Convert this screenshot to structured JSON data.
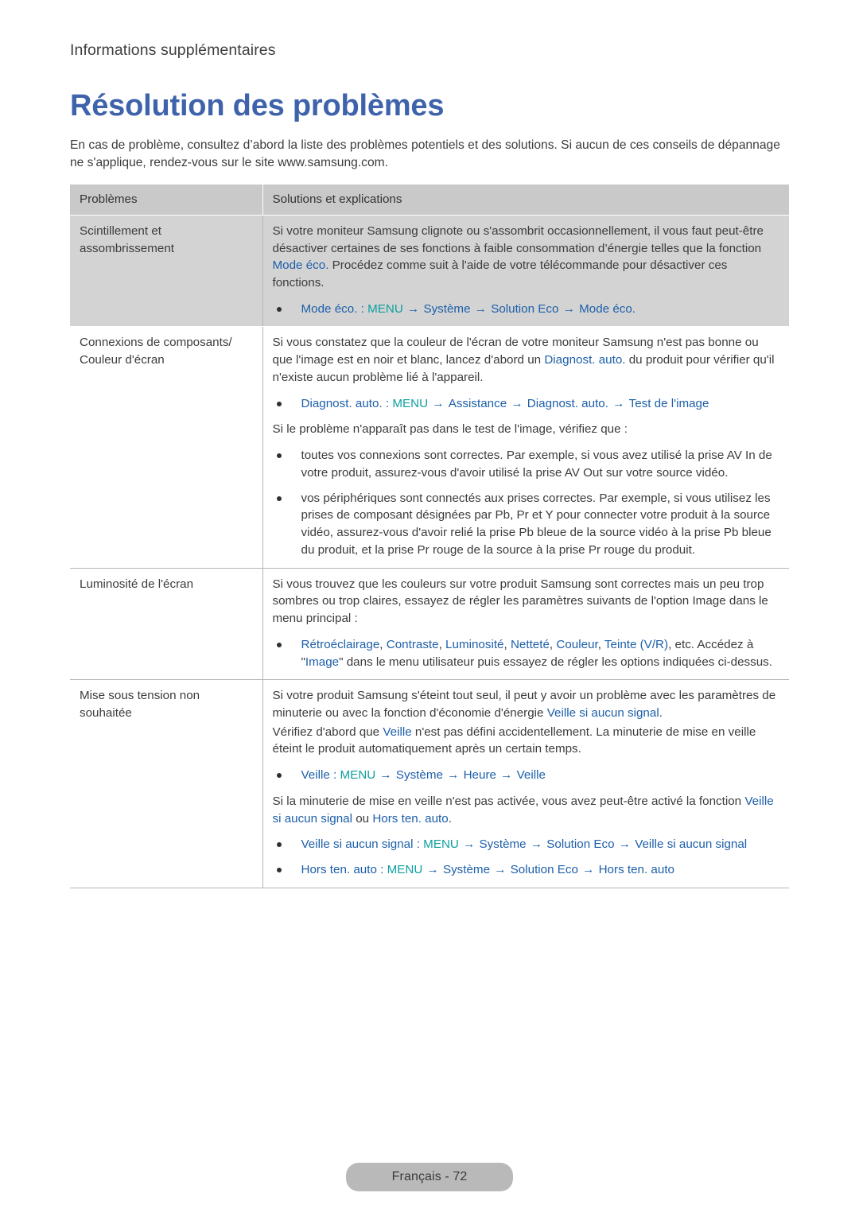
{
  "page": {
    "running_head": "Informations supplémentaires",
    "title": "Résolution des problèmes",
    "intro": "En cas de problème, consultez d’abord la liste des problèmes potentiels et des solutions. Si aucun de ces conseils de dépannage ne s'applique, rendez-vous sur le site www.samsung.com.",
    "footer": "Français - 72"
  },
  "colors": {
    "title_blue": "#3f63ab",
    "link_blue": "#1d5fa9",
    "menu_teal": "#0f9f9f",
    "header_gray": "#c9c9c9",
    "row_gray": "#d3d3d3",
    "rule_gray": "#b5b5b5",
    "footer_pill": "#b9b9b9",
    "body_text": "#3c3c3c"
  },
  "table": {
    "headers": {
      "problems": "Problèmes",
      "solutions": "Solutions et explications"
    },
    "rows": [
      {
        "shaded": true,
        "problem": "Scintillement et assombrissement",
        "blocks": [
          {
            "type": "paragraph",
            "runs": [
              {
                "t": "Si votre moniteur Samsung clignote ou s'assombrit occasionnellement, il vous faut peut-être désactiver certaines de ses fonctions à faible consommation d’énergie telles que la fonction ",
                "c": "dark"
              },
              {
                "t": "Mode éco.",
                "c": "blue"
              },
              {
                "t": " Procédez comme suit à l'aide de votre télécommande pour désactiver ces fonctions.",
                "c": "dark"
              }
            ]
          },
          {
            "type": "bullets",
            "items": [
              {
                "runs": [
                  {
                    "t": "Mode éco.",
                    "c": "blue"
                  },
                  {
                    "t": " : ",
                    "c": "blue"
                  },
                  {
                    "t": "MENU",
                    "c": "teal"
                  },
                  {
                    "t": " → ",
                    "c": "arrow"
                  },
                  {
                    "t": "Système",
                    "c": "blue"
                  },
                  {
                    "t": " → ",
                    "c": "arrow"
                  },
                  {
                    "t": "Solution Eco",
                    "c": "blue"
                  },
                  {
                    "t": " → ",
                    "c": "arrow"
                  },
                  {
                    "t": "Mode éco.",
                    "c": "blue"
                  }
                ]
              }
            ]
          }
        ]
      },
      {
        "shaded": false,
        "problem": "Connexions de composants/ Couleur d'écran",
        "blocks": [
          {
            "type": "paragraph",
            "runs": [
              {
                "t": "Si vous constatez que la couleur de l'écran de votre moniteur Samsung n'est pas bonne ou que l'image est en noir et blanc, lancez d'abord un ",
                "c": "dark"
              },
              {
                "t": "Diagnost. auto.",
                "c": "blue"
              },
              {
                "t": " du produit pour vérifier qu'il n'existe aucun problème lié à l'appareil.",
                "c": "dark"
              }
            ]
          },
          {
            "type": "bullets",
            "items": [
              {
                "runs": [
                  {
                    "t": "Diagnost. auto.",
                    "c": "blue"
                  },
                  {
                    "t": " : ",
                    "c": "blue"
                  },
                  {
                    "t": "MENU",
                    "c": "teal"
                  },
                  {
                    "t": " → ",
                    "c": "arrow"
                  },
                  {
                    "t": "Assistance",
                    "c": "blue"
                  },
                  {
                    "t": " → ",
                    "c": "arrow"
                  },
                  {
                    "t": "Diagnost. auto.",
                    "c": "blue"
                  },
                  {
                    "t": " → ",
                    "c": "arrow"
                  },
                  {
                    "t": "Test de l'image",
                    "c": "blue"
                  }
                ]
              }
            ]
          },
          {
            "type": "paragraph",
            "runs": [
              {
                "t": "Si le problème n'apparaît pas dans le test de l'image, vérifiez que :",
                "c": "dark"
              }
            ]
          },
          {
            "type": "bullets",
            "items": [
              {
                "runs": [
                  {
                    "t": "toutes vos connexions sont correctes. Par exemple, si vous avez utilisé la prise AV In de votre produit, assurez-vous d'avoir utilisé la prise AV Out sur votre source vidéo.",
                    "c": "dark"
                  }
                ]
              },
              {
                "runs": [
                  {
                    "t": "vos périphériques sont connectés aux prises correctes. Par exemple, si vous utilisez les prises de composant désignées par Pb, Pr et Y pour connecter votre produit à la source vidéo, assurez-vous d'avoir relié la prise Pb bleue de la source vidéo à la prise Pb bleue du produit, et la prise Pr rouge de la source à la prise Pr rouge du produit.",
                    "c": "dark"
                  }
                ]
              }
            ]
          }
        ]
      },
      {
        "shaded": false,
        "problem": "Luminosité de l'écran",
        "blocks": [
          {
            "type": "paragraph",
            "runs": [
              {
                "t": "Si vous trouvez que les couleurs sur votre produit Samsung sont correctes mais un peu trop sombres ou trop claires, essayez de régler les paramètres suivants de l'option Image dans le menu principal :",
                "c": "dark"
              }
            ]
          },
          {
            "type": "bullets",
            "items": [
              {
                "runs": [
                  {
                    "t": "Rétroéclairage",
                    "c": "blue"
                  },
                  {
                    "t": ", ",
                    "c": "dark"
                  },
                  {
                    "t": "Contraste",
                    "c": "blue"
                  },
                  {
                    "t": ", ",
                    "c": "dark"
                  },
                  {
                    "t": "Luminosité",
                    "c": "blue"
                  },
                  {
                    "t": ", ",
                    "c": "dark"
                  },
                  {
                    "t": "Netteté",
                    "c": "blue"
                  },
                  {
                    "t": ", ",
                    "c": "dark"
                  },
                  {
                    "t": "Couleur",
                    "c": "blue"
                  },
                  {
                    "t": ", ",
                    "c": "dark"
                  },
                  {
                    "t": "Teinte (V/R)",
                    "c": "blue"
                  },
                  {
                    "t": ", etc. Accédez à \"",
                    "c": "dark"
                  },
                  {
                    "t": "Image",
                    "c": "blue"
                  },
                  {
                    "t": "\" dans le menu utilisateur puis essayez de régler les options indiquées ci-dessus.",
                    "c": "dark"
                  }
                ]
              }
            ]
          }
        ]
      },
      {
        "shaded": false,
        "problem": "Mise sous tension non souhaitée",
        "blocks": [
          {
            "type": "paragraph",
            "runs": [
              {
                "t": "Si votre produit Samsung s'éteint tout seul, il peut y avoir un problème avec les paramètres de minuterie ou avec la fonction d'économie d'énergie ",
                "c": "dark"
              },
              {
                "t": "Veille si aucun signal",
                "c": "blue"
              },
              {
                "t": ".",
                "c": "dark"
              }
            ]
          },
          {
            "type": "paragraph",
            "tight": true,
            "runs": [
              {
                "t": "Vérifiez d'abord que ",
                "c": "dark"
              },
              {
                "t": "Veille",
                "c": "blue"
              },
              {
                "t": " n'est pas défini accidentellement. La minuterie de mise en veille éteint le produit automatiquement après un certain temps.",
                "c": "dark"
              }
            ]
          },
          {
            "type": "bullets",
            "items": [
              {
                "runs": [
                  {
                    "t": "Veille",
                    "c": "blue"
                  },
                  {
                    "t": " : ",
                    "c": "blue"
                  },
                  {
                    "t": "MENU",
                    "c": "teal"
                  },
                  {
                    "t": " → ",
                    "c": "arrow"
                  },
                  {
                    "t": "Système",
                    "c": "blue"
                  },
                  {
                    "t": " → ",
                    "c": "arrow"
                  },
                  {
                    "t": "Heure",
                    "c": "blue"
                  },
                  {
                    "t": " → ",
                    "c": "arrow"
                  },
                  {
                    "t": "Veille",
                    "c": "blue"
                  }
                ]
              }
            ]
          },
          {
            "type": "paragraph",
            "runs": [
              {
                "t": "Si la minuterie de mise en veille n'est pas activée, vous avez peut-être activé la fonction ",
                "c": "dark"
              },
              {
                "t": "Veille si aucun signal",
                "c": "blue"
              },
              {
                "t": " ou ",
                "c": "dark"
              },
              {
                "t": "Hors ten. auto",
                "c": "blue"
              },
              {
                "t": ".",
                "c": "dark"
              }
            ]
          },
          {
            "type": "bullets",
            "items": [
              {
                "runs": [
                  {
                    "t": "Veille si aucun signal",
                    "c": "blue"
                  },
                  {
                    "t": " : ",
                    "c": "blue"
                  },
                  {
                    "t": "MENU",
                    "c": "teal"
                  },
                  {
                    "t": " → ",
                    "c": "arrow"
                  },
                  {
                    "t": "Système",
                    "c": "blue"
                  },
                  {
                    "t": " → ",
                    "c": "arrow"
                  },
                  {
                    "t": "Solution Eco",
                    "c": "blue"
                  },
                  {
                    "t": " → ",
                    "c": "arrow"
                  },
                  {
                    "t": "Veille si aucun signal",
                    "c": "blue"
                  }
                ]
              },
              {
                "runs": [
                  {
                    "t": "Hors ten. auto",
                    "c": "blue"
                  },
                  {
                    "t": " : ",
                    "c": "blue"
                  },
                  {
                    "t": "MENU",
                    "c": "teal"
                  },
                  {
                    "t": " → ",
                    "c": "arrow"
                  },
                  {
                    "t": "Système",
                    "c": "blue"
                  },
                  {
                    "t": " → ",
                    "c": "arrow"
                  },
                  {
                    "t": "Solution Eco",
                    "c": "blue"
                  },
                  {
                    "t": " → ",
                    "c": "arrow"
                  },
                  {
                    "t": "Hors ten. auto",
                    "c": "blue"
                  }
                ]
              }
            ]
          }
        ]
      }
    ]
  }
}
